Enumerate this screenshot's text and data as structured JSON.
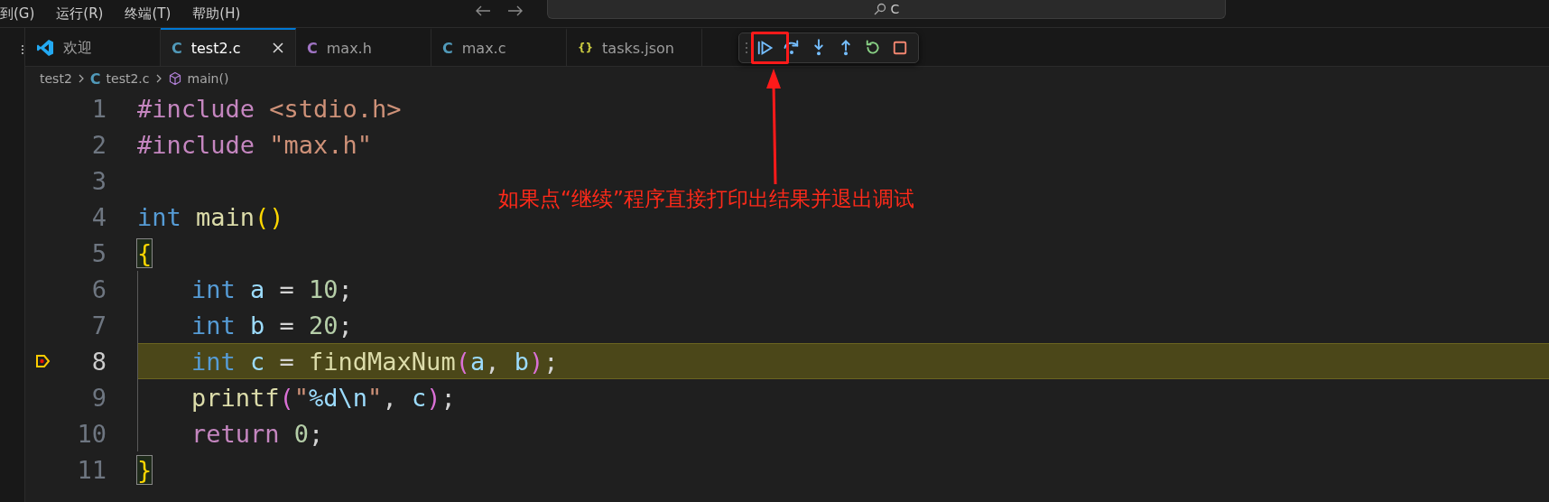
{
  "menu": [
    {
      "label": "到(G)"
    },
    {
      "label": "运行(R)"
    },
    {
      "label": "终端(T)"
    },
    {
      "label": "帮助(H)"
    }
  ],
  "title_bar": {
    "search": {
      "value": "C"
    }
  },
  "tabs": [
    {
      "label": "欢迎",
      "kind": "vscode",
      "selected": false
    },
    {
      "label": "test2.c",
      "icon": "C",
      "kind": "c",
      "selected": true
    },
    {
      "label": "max.h",
      "icon": "C",
      "kind": "h",
      "selected": false
    },
    {
      "label": "max.c",
      "icon": "C",
      "kind": "c",
      "selected": false
    },
    {
      "label": "tasks.json",
      "icon": "{}",
      "kind": "json",
      "selected": false
    }
  ],
  "debug_toolbar": [
    {
      "kind": "continue"
    },
    {
      "kind": "step-over"
    },
    {
      "kind": "step-into"
    },
    {
      "kind": "step-out"
    },
    {
      "kind": "restart"
    },
    {
      "kind": "stop"
    }
  ],
  "breadcrumb": [
    {
      "label": "test2",
      "kind": "folder"
    },
    {
      "label": "test2.c",
      "icon": "C",
      "kind": "file"
    },
    {
      "label": "main()",
      "kind": "symbol"
    }
  ],
  "code": [
    {
      "number": "1",
      "current": false,
      "indented": false,
      "tokens": [
        {
          "text": "#include ",
          "kind": "directive"
        },
        {
          "text": "<stdio.h>",
          "kind": "string"
        }
      ]
    },
    {
      "number": "2",
      "current": false,
      "indented": false,
      "tokens": [
        {
          "text": "#include ",
          "kind": "directive"
        },
        {
          "text": "\"max.h\"",
          "kind": "string"
        }
      ]
    },
    {
      "number": "3",
      "current": false,
      "indented": false
    },
    {
      "number": "4",
      "current": false,
      "indented": false,
      "tokens": [
        {
          "text": "int ",
          "kind": "type"
        },
        {
          "text": "main",
          "kind": "func"
        },
        {
          "text": "()",
          "kind": "bracket"
        }
      ]
    },
    {
      "number": "5",
      "current": false,
      "indented": false,
      "tokens": [
        {
          "text": "{",
          "kind": "brace-match"
        }
      ]
    },
    {
      "number": "6",
      "current": false,
      "indented": true,
      "tokens": [
        {
          "text": "int ",
          "kind": "type"
        },
        {
          "text": "a",
          "kind": "var"
        },
        {
          "text": " = ",
          "kind": "plain"
        },
        {
          "text": "10",
          "kind": "number"
        },
        {
          "text": ";",
          "kind": "plain"
        }
      ]
    },
    {
      "number": "7",
      "current": false,
      "indented": true,
      "tokens": [
        {
          "text": "int ",
          "kind": "type"
        },
        {
          "text": "b",
          "kind": "var"
        },
        {
          "text": " = ",
          "kind": "plain"
        },
        {
          "text": "20",
          "kind": "number"
        },
        {
          "text": ";",
          "kind": "plain"
        }
      ]
    },
    {
      "number": "8",
      "current": true,
      "indented": true,
      "tokens": [
        {
          "text": "int ",
          "kind": "type"
        },
        {
          "text": "c",
          "kind": "var"
        },
        {
          "text": " = ",
          "kind": "plain"
        },
        {
          "text": "findMaxNum",
          "kind": "func"
        },
        {
          "text": "(",
          "kind": "bracket2"
        },
        {
          "text": "a",
          "kind": "var"
        },
        {
          "text": ", ",
          "kind": "plain"
        },
        {
          "text": "b",
          "kind": "var"
        },
        {
          "text": ")",
          "kind": "bracket2"
        },
        {
          "text": ";",
          "kind": "plain"
        }
      ]
    },
    {
      "number": "9",
      "current": false,
      "indented": true,
      "tokens": [
        {
          "text": "printf",
          "kind": "func"
        },
        {
          "text": "(",
          "kind": "bracket2"
        },
        {
          "text": "\"",
          "kind": "string"
        },
        {
          "text": "%d\\n",
          "kind": "var"
        },
        {
          "text": "\"",
          "kind": "string"
        },
        {
          "text": ", ",
          "kind": "plain"
        },
        {
          "text": "c",
          "kind": "var"
        },
        {
          "text": ")",
          "kind": "bracket2"
        },
        {
          "text": ";",
          "kind": "plain"
        }
      ]
    },
    {
      "number": "10",
      "current": false,
      "indented": true,
      "tokens": [
        {
          "text": "return ",
          "kind": "directive"
        },
        {
          "text": "0",
          "kind": "number"
        },
        {
          "text": ";",
          "kind": "plain"
        }
      ]
    },
    {
      "number": "11",
      "current": false,
      "indented": false,
      "tokens": [
        {
          "text": "}",
          "kind": "brace-match"
        }
      ]
    }
  ],
  "annotation": {
    "text": "如果点“继续”程序直接打印出结果并退出调试"
  }
}
